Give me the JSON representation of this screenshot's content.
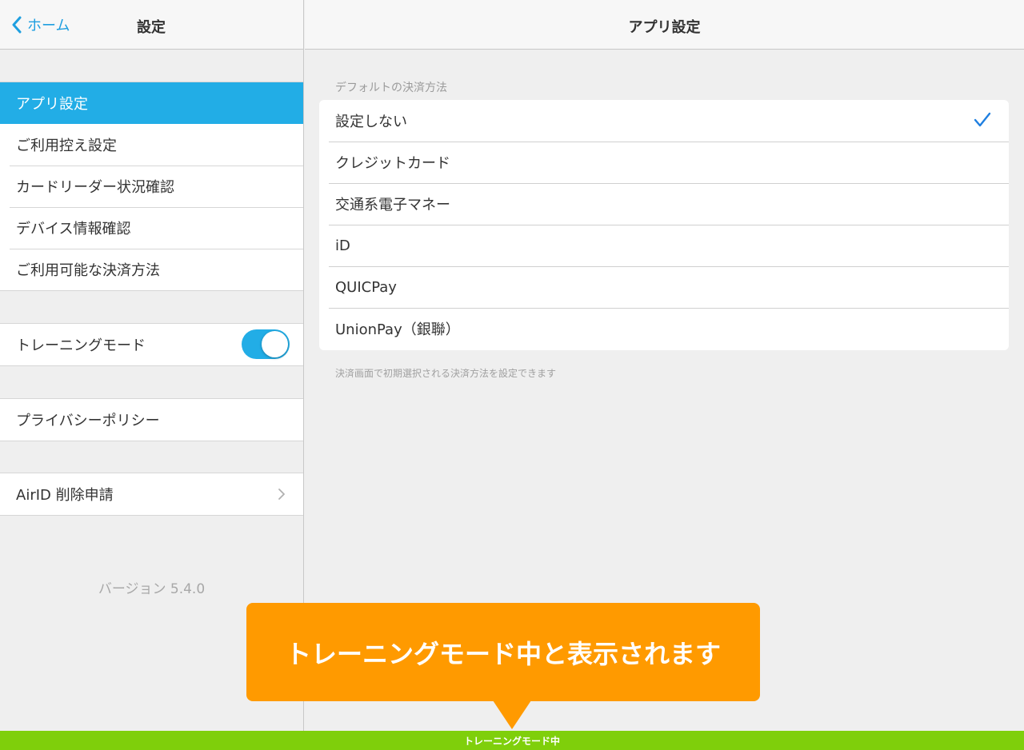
{
  "left": {
    "back_label": "ホーム",
    "title": "設定",
    "menu": [
      {
        "label": "アプリ設定",
        "selected": true
      },
      {
        "label": "ご利用控え設定"
      },
      {
        "label": "カードリーダー状況確認"
      },
      {
        "label": "デバイス情報確認"
      },
      {
        "label": "ご利用可能な決済方法"
      }
    ],
    "training_mode": {
      "label": "トレーニングモード",
      "enabled": true
    },
    "privacy_label": "プライバシーポリシー",
    "airid_delete_label": "AirID 削除申請",
    "version": "バージョン 5.4.0"
  },
  "right": {
    "title": "アプリ設定",
    "section_header": "デフォルトの決済方法",
    "options": [
      {
        "label": "設定しない",
        "checked": true
      },
      {
        "label": "クレジットカード"
      },
      {
        "label": "交通系電子マネー"
      },
      {
        "label": "iD"
      },
      {
        "label": "QUICPay"
      },
      {
        "label": "UnionPay（銀聯）"
      }
    ],
    "section_footer": "決済画面で初期選択される決済方法を設定できます"
  },
  "callout": {
    "text": "トレーニングモード中と表示されます"
  },
  "training_bar": {
    "text": "トレーニングモード中"
  },
  "colors": {
    "accent": "#22ade6",
    "callout": "#ff9a00",
    "training_bar": "#7fcf0b",
    "check": "#1f7fe0"
  }
}
